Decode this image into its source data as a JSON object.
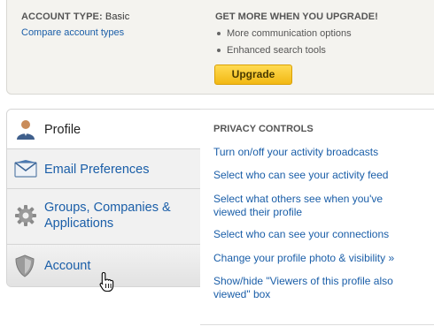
{
  "account": {
    "type_label": "ACCOUNT TYPE:",
    "type_value": "Basic",
    "compare_link": "Compare account types"
  },
  "upgrade": {
    "heading": "GET MORE WHEN YOU UPGRADE!",
    "benefits": [
      "More communication options",
      "Enhanced search tools"
    ],
    "button_label": "Upgrade",
    "button_color": "#f5c22a"
  },
  "nav": {
    "items": [
      {
        "label": "Profile",
        "icon": "person-icon",
        "state": "active"
      },
      {
        "label": "Email Preferences",
        "icon": "envelope-icon",
        "state": "normal"
      },
      {
        "label": "Groups, Companies & Applications",
        "icon": "gear-icon",
        "state": "normal"
      },
      {
        "label": "Account",
        "icon": "shield-icon",
        "state": "hover"
      }
    ]
  },
  "privacy": {
    "heading": "PRIVACY CONTROLS",
    "links": [
      "Turn on/off your activity broadcasts",
      "Select who can see your activity feed",
      "Select what others see when you've viewed their profile",
      "Select who can see your connections",
      "Change your profile photo & visibility »",
      "Show/hide \"Viewers of this profile also viewed\" box"
    ]
  },
  "colors": {
    "link": "#1a5ea8",
    "banner_bg": "#f4f3ef",
    "nav_bg": "#f1f1f1"
  },
  "cursor": {
    "icon": "hand-pointer-icon"
  }
}
